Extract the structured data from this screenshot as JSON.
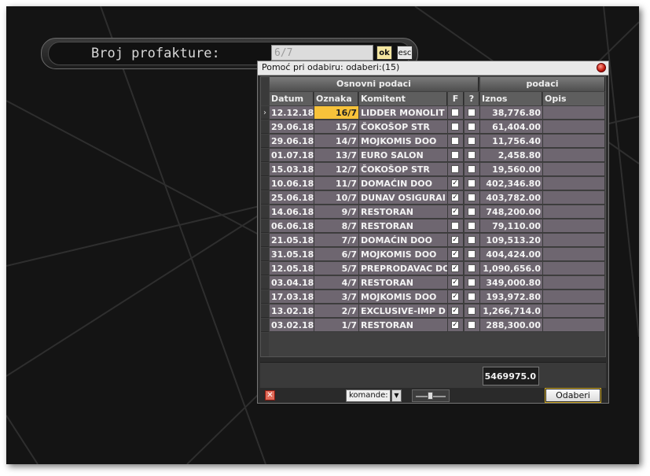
{
  "prompt": {
    "label": "Broj profakture:",
    "input_value": "6/7",
    "ok_label": "ok",
    "esc_label": "esc"
  },
  "dialog": {
    "title": "Pomoć pri odabiru: odaberi:(15)",
    "groups": {
      "main": "Osnovni podaci",
      "extra": "podaci"
    },
    "columns": [
      "Datum",
      "Oznaka",
      "Komitent",
      "F",
      "?",
      "Iznos",
      "Opis"
    ],
    "rows": [
      {
        "datum": "12.12.18",
        "oznaka": "16/7",
        "komitent": "LIDDER MONOLIT",
        "f": false,
        "q": false,
        "iznos": "38,776.80",
        "opis": "",
        "current": true
      },
      {
        "datum": "29.06.18",
        "oznaka": "15/7",
        "komitent": "ČOKOŠOP STR",
        "f": false,
        "q": false,
        "iznos": "61,404.00",
        "opis": ""
      },
      {
        "datum": "29.06.18",
        "oznaka": "14/7",
        "komitent": "MOJKOMIS DOO",
        "f": false,
        "q": false,
        "iznos": "11,756.40",
        "opis": ""
      },
      {
        "datum": "01.07.18",
        "oznaka": "13/7",
        "komitent": "EURO SALON",
        "f": false,
        "q": false,
        "iznos": "2,458.80",
        "opis": ""
      },
      {
        "datum": "15.03.18",
        "oznaka": "12/7",
        "komitent": "ČOKOŠOP STR",
        "f": false,
        "q": false,
        "iznos": "19,560.00",
        "opis": ""
      },
      {
        "datum": "10.06.18",
        "oznaka": "11/7",
        "komitent": "DOMAĆIN DOO",
        "f": true,
        "q": false,
        "iznos": "402,346.80",
        "opis": ""
      },
      {
        "datum": "25.06.18",
        "oznaka": "10/7",
        "komitent": "DUNAV OSIGURAI",
        "f": true,
        "q": false,
        "iznos": "403,782.00",
        "opis": ""
      },
      {
        "datum": "14.06.18",
        "oznaka": "9/7",
        "komitent": "RESTORAN",
        "f": true,
        "q": false,
        "iznos": "748,200.00",
        "opis": ""
      },
      {
        "datum": "06.06.18",
        "oznaka": "8/7",
        "komitent": "RESTORAN",
        "f": false,
        "q": false,
        "iznos": "79,110.00",
        "opis": ""
      },
      {
        "datum": "21.05.18",
        "oznaka": "7/7",
        "komitent": "DOMAĆIN DOO",
        "f": true,
        "q": false,
        "iznos": "109,513.20",
        "opis": ""
      },
      {
        "datum": "31.05.18",
        "oznaka": "6/7",
        "komitent": "MOJKOMIS DOO",
        "f": true,
        "q": false,
        "iznos": "404,424.00",
        "opis": ""
      },
      {
        "datum": "12.05.18",
        "oznaka": "5/7",
        "komitent": "PREPRODAVAC DO",
        "f": true,
        "q": false,
        "iznos": "1,090,656.0",
        "opis": ""
      },
      {
        "datum": "03.04.18",
        "oznaka": "4/7",
        "komitent": "RESTORAN",
        "f": true,
        "q": false,
        "iznos": "349,000.80",
        "opis": ""
      },
      {
        "datum": "17.03.18",
        "oznaka": "3/7",
        "komitent": "MOJKOMIS DOO",
        "f": true,
        "q": false,
        "iznos": "193,972.80",
        "opis": ""
      },
      {
        "datum": "13.02.18",
        "oznaka": "2/7",
        "komitent": "EXCLUSIVE-IMP D",
        "f": true,
        "q": false,
        "iznos": "1,266,714.0",
        "opis": ""
      },
      {
        "datum": "03.02.18",
        "oznaka": "1/7",
        "komitent": "RESTORAN",
        "f": true,
        "q": false,
        "iznos": "288,300.00",
        "opis": ""
      }
    ],
    "total": "5469975.0",
    "komande_label": "komande:",
    "odaberi_label": "Odaberi",
    "row_indicator": "›",
    "check_mark": "✓",
    "close_x": "✕"
  }
}
